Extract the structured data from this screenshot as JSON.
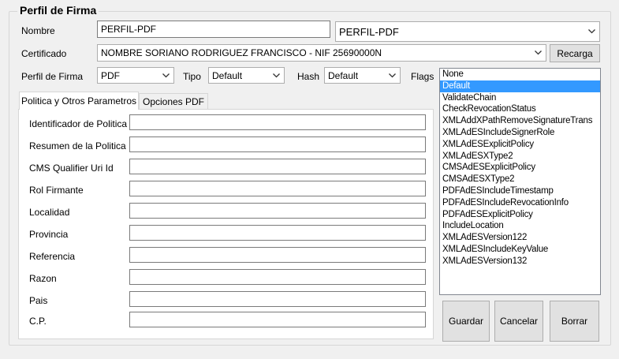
{
  "group_title": "Perfil de Firma",
  "nombre": {
    "label": "Nombre",
    "value": "PERFIL-PDF",
    "combo_value": "PERFIL-PDF"
  },
  "certificado": {
    "label": "Certificado",
    "value": "NOMBRE SORIANO RODRIGUEZ FRANCISCO - NIF 25690000N",
    "reload_label": "Recarga"
  },
  "perfil": {
    "label": "Perfil de Firma",
    "value": "PDF"
  },
  "tipo": {
    "label": "Tipo",
    "value": "Default"
  },
  "hash": {
    "label": "Hash",
    "value": "Default"
  },
  "flags": {
    "label": "Flags",
    "selected": "Default",
    "items": [
      "None",
      "Default",
      "ValidateChain",
      "CheckRevocationStatus",
      "XMLAddXPathRemoveSignatureTrans",
      "XMLAdESIncludeSignerRole",
      "XMLAdESExplicitPolicy",
      "XMLAdESXType2",
      "CMSAdESExplicitPolicy",
      "CMSAdESXType2",
      "PDFAdESIncludeTimestamp",
      "PDFAdESIncludeRevocationInfo",
      "PDFAdESExplicitPolicy",
      "IncludeLocation",
      "XMLAdESVersion122",
      "XMLAdESIncludeKeyValue",
      "XMLAdESVersion132"
    ]
  },
  "tabs": [
    {
      "label": "Politica y Otros Parametros",
      "active": true
    },
    {
      "label": "Opciones PDF",
      "active": false
    }
  ],
  "fields": [
    {
      "label": "Identificador de Politica",
      "value": ""
    },
    {
      "label": "Resumen de la Politica",
      "value": ""
    },
    {
      "label": "CMS Qualifier Uri Id",
      "value": ""
    },
    {
      "label": "Rol Firmante",
      "value": ""
    },
    {
      "label": "Localidad",
      "value": ""
    },
    {
      "label": "Provincia",
      "value": ""
    },
    {
      "label": "Referencia",
      "value": ""
    },
    {
      "label": "Razon",
      "value": ""
    },
    {
      "label": "Pais",
      "value": ""
    },
    {
      "label": "C.P.",
      "value": ""
    }
  ],
  "buttons": {
    "save": "Guardar",
    "cancel": "Cancelar",
    "delete": "Borrar"
  },
  "icons": {
    "dropdown": "chevron-down-icon"
  },
  "colors": {
    "selection": "#3399ff",
    "window": "#f0f0f0"
  }
}
